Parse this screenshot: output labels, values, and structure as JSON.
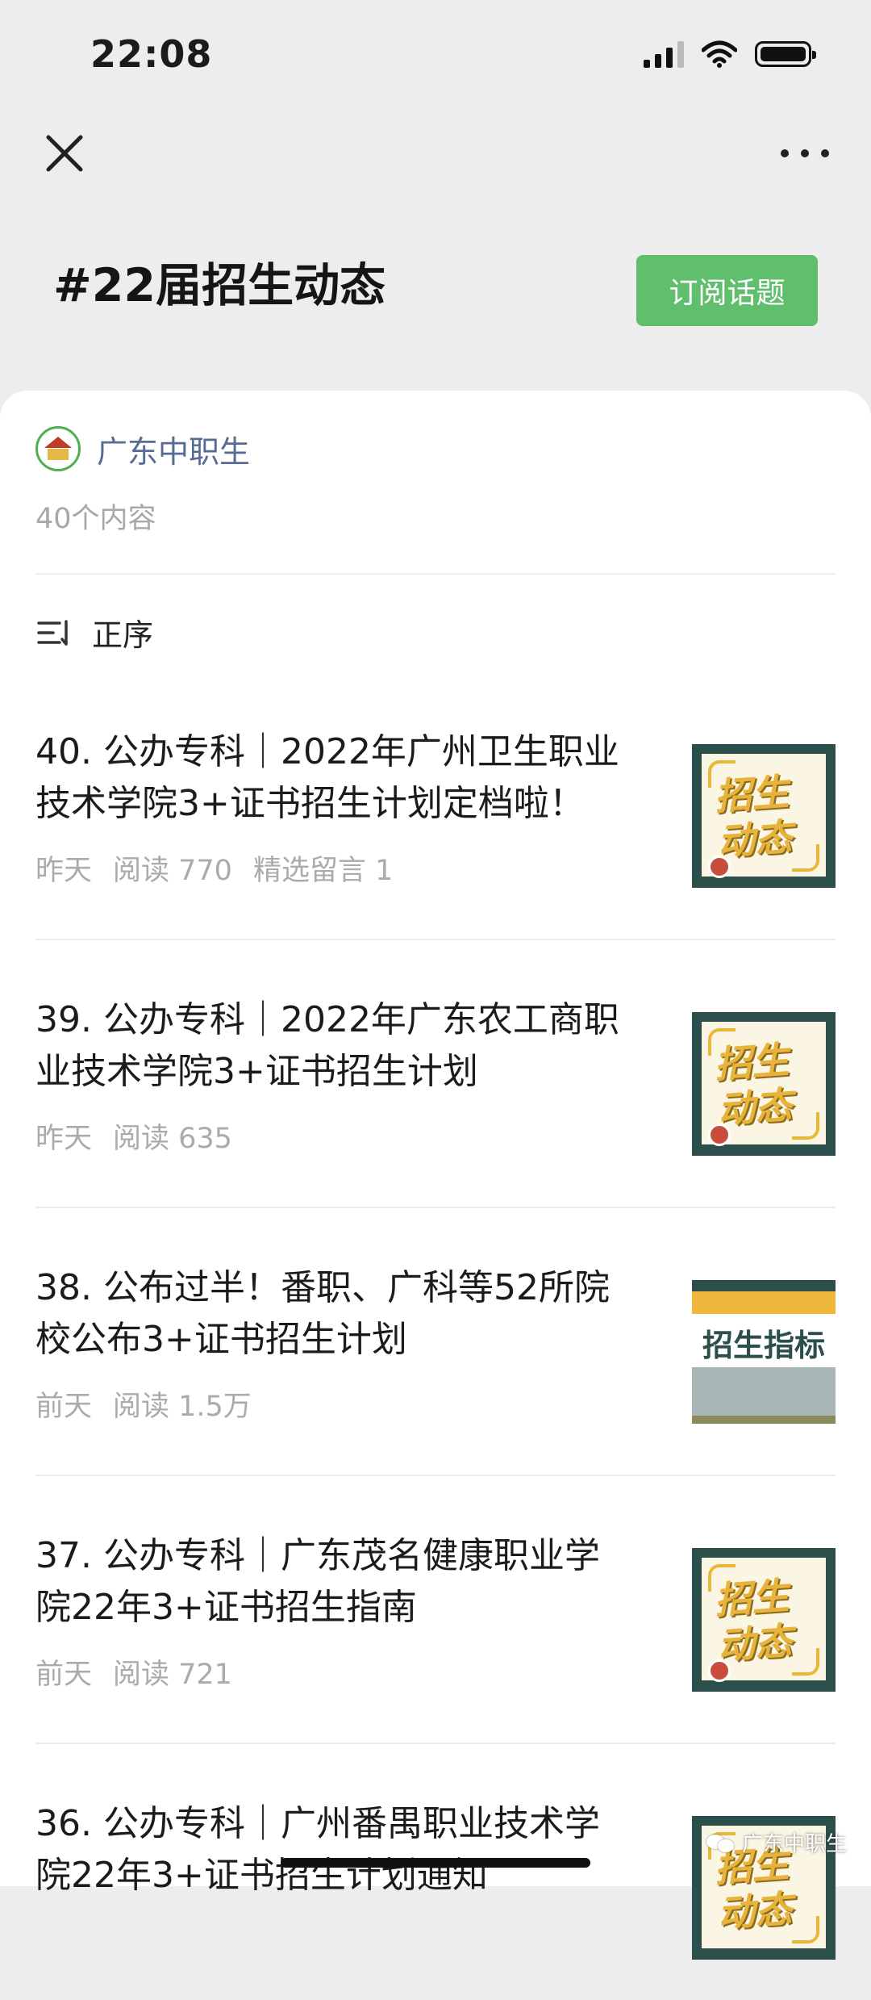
{
  "status_bar": {
    "time": "22:08"
  },
  "nav": {
    "close_icon": "close-icon",
    "more_icon": "more-icon"
  },
  "topic": {
    "title": "#22届招生动态",
    "subscribe_label": "订阅话题",
    "subscribe_color": "#5fbf6c"
  },
  "account": {
    "name": "广东中职生",
    "content_count": "40个内容",
    "name_color": "#576b95"
  },
  "sort": {
    "label": "正序",
    "icon": "sort-icon"
  },
  "articles": [
    {
      "line1": "40. 公办专科｜2022年广州卫生职业",
      "line2": "技术学院3+证书招生计划定档啦！",
      "meta": [
        "昨天",
        "阅读 770",
        "精选留言 1"
      ],
      "thumb_text": [
        "招生",
        "动态"
      ]
    },
    {
      "line1": "39. 公办专科｜2022年广东农工商职",
      "line2": "业技术学院3+证书招生计划",
      "meta": [
        "昨天",
        "阅读 635"
      ],
      "thumb_text": [
        "招生",
        "动态"
      ]
    },
    {
      "line1": "38. 公布过半！番职、广科等52所院",
      "line2": "校公布3+证书招生计划",
      "meta": [
        "前天",
        "阅读 1.5万"
      ],
      "thumb_text": [
        "招生指标"
      ]
    },
    {
      "line1": "37. 公办专科｜广东茂名健康职业学",
      "line2": "院22年3+证书招生指南",
      "meta": [
        "前天",
        "阅读 721"
      ],
      "thumb_text": [
        "招生",
        "动态"
      ]
    },
    {
      "line1": "36. 公办专科｜广州番禺职业技术学",
      "line2": "院22年3+证书招生计划通知",
      "meta": [],
      "thumb_text": [
        "招生",
        "动态"
      ]
    }
  ],
  "watermark": {
    "text": "广东中职生"
  }
}
